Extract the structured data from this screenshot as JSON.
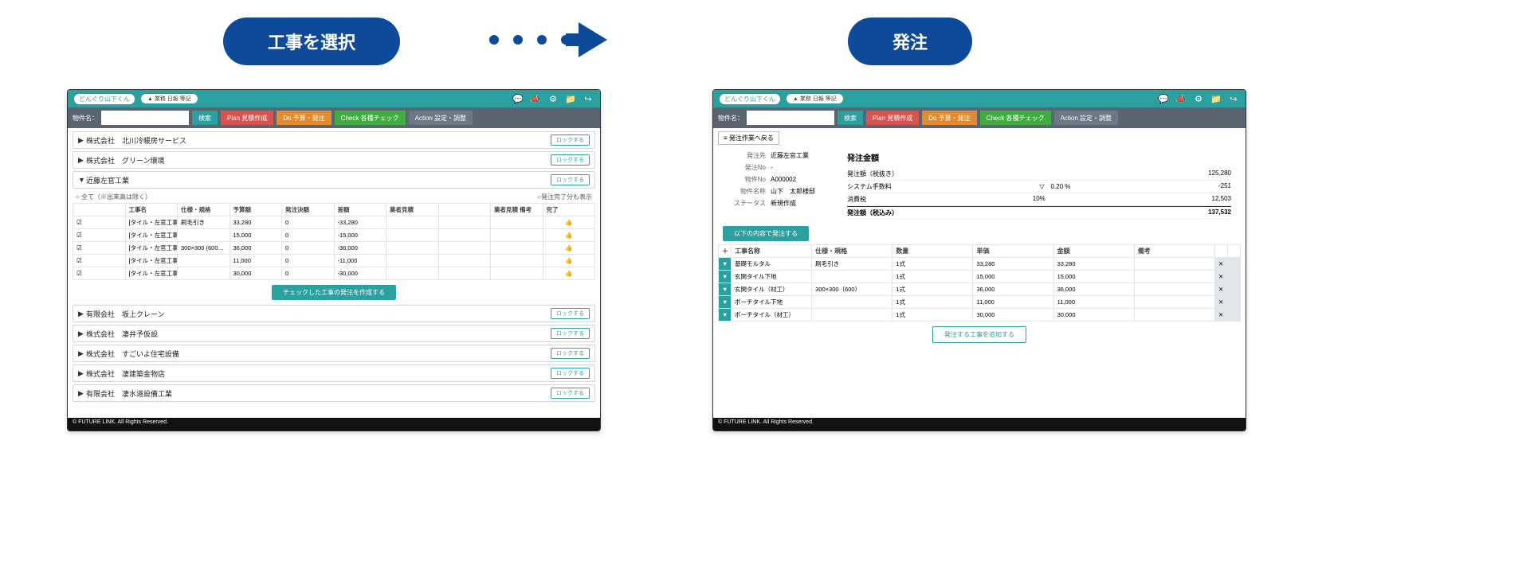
{
  "pills": {
    "left": "工事を選択",
    "right": "発注"
  },
  "topbar": {
    "logo": "どんぐり山下くん",
    "user_badge": "▲ 業務 日報 等記",
    "icons": [
      "chat-icon",
      "announce-icon",
      "gear-icon",
      "folder-icon",
      "logout-icon"
    ]
  },
  "searchbar": {
    "label": "物件名：",
    "placeholder": "",
    "search_btn": "検索",
    "nav": {
      "plan": "Plan 見積作成",
      "do": "Do 予算・発注",
      "check": "Check 各種チェック",
      "action": "Action 設定・調整"
    }
  },
  "footer": "© FUTURE LINK. All Rights Reserved.",
  "left_window": {
    "companies_above": [
      "株式会社　北川冷暖房サービス",
      "株式会社　グリーン環境"
    ],
    "expanded_company": "近藤左官工業",
    "lock_label": "ロックする",
    "opt_all": "○ 全て（※出来高は除く）",
    "opt_done": "○発注完了分も表示",
    "columns": [
      "",
      "工事名",
      "仕様・規格",
      "予算額",
      "発注決額",
      "差額",
      "業者見積",
      "",
      "業者見積 備考",
      "完了"
    ],
    "rows": [
      {
        "name": "[タイル・左官工事] 基礎モルタル",
        "spec": "刷毛引き",
        "budget": "33,280",
        "ordered": "0",
        "diff": "-33,280"
      },
      {
        "name": "[タイル・左官工事] 玄関タイル下地",
        "spec": "",
        "budget": "15,000",
        "ordered": "0",
        "diff": "-15,000"
      },
      {
        "name": "[タイル・左官工事] 玄関タイル（材工…",
        "spec": "300×300 (600…",
        "budget": "36,000",
        "ordered": "0",
        "diff": "-36,000"
      },
      {
        "name": "[タイル・左官工事] ポーチタイル下地",
        "spec": "",
        "budget": "11,000",
        "ordered": "0",
        "diff": "-11,000"
      },
      {
        "name": "[タイル・左官工事] ポーチタイル（材…",
        "spec": "",
        "budget": "30,000",
        "ordered": "0",
        "diff": "-30,000"
      }
    ],
    "create_btn": "チェックした工事の発注を作成する",
    "companies_below": [
      "有限会社　坂上クレーン",
      "株式会社　凄井予仮設",
      "株式会社　すごいよ住宅設備",
      "株式会社　凄建築金物店",
      "有限会社　凄水道設備工業"
    ]
  },
  "right_window": {
    "back_btn": "≡ 発注作業へ戻る",
    "detail_labels": {
      "vendor": "発注先",
      "order_no": "発注No",
      "prop_no": "物件No",
      "prop_name": "物件名称",
      "status": "ステータス"
    },
    "detail_values": {
      "vendor": "近藤左官工業",
      "order_no": "-",
      "prop_no": "A000002",
      "prop_name": "山下　太郎様邸",
      "status": "新規作成"
    },
    "money_title": "発注金額",
    "money_rows": [
      {
        "label": "発注額（税抜き）",
        "mid": "",
        "val": "125,280"
      },
      {
        "label": "システム手数料",
        "mid": "▽　0.20 %",
        "val": "-251"
      },
      {
        "label": "消費税",
        "mid": "10%",
        "val": "12,503"
      },
      {
        "label": "発注額（税込み）",
        "mid": "",
        "val": "137,532"
      }
    ],
    "issue_btn": "以下の内容で発注する",
    "item_columns": [
      "工事名称",
      "仕様・規格",
      "数量",
      "単価",
      "金額",
      "備考"
    ],
    "items": [
      {
        "name": "基礎モルタル",
        "spec": "刷毛引き",
        "qty": "1式",
        "unit": "33,280",
        "amount": "33,280"
      },
      {
        "name": "玄関タイル下地",
        "spec": "",
        "qty": "1式",
        "unit": "15,000",
        "amount": "15,000"
      },
      {
        "name": "玄関タイル（材工）",
        "spec": "300×300（600）",
        "qty": "1式",
        "unit": "36,000",
        "amount": "36,000"
      },
      {
        "name": "ポーチタイル下地",
        "spec": "",
        "qty": "1式",
        "unit": "11,000",
        "amount": "11,000"
      },
      {
        "name": "ポーチタイル（材工）",
        "spec": "",
        "qty": "1式",
        "unit": "30,000",
        "amount": "30,000"
      }
    ],
    "add_btn": "発注する工事を追加する"
  }
}
